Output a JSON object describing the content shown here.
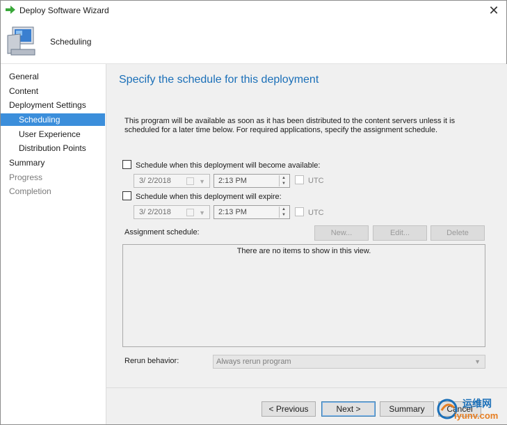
{
  "window": {
    "title": "Deploy Software Wizard",
    "close_glyph": "✕"
  },
  "header": {
    "title": "Scheduling",
    "icon": "computer-icon"
  },
  "nav": {
    "items": [
      {
        "label": "General",
        "level": "top",
        "state": "normal"
      },
      {
        "label": "Content",
        "level": "top",
        "state": "normal"
      },
      {
        "label": "Deployment Settings",
        "level": "top",
        "state": "normal"
      },
      {
        "label": "Scheduling",
        "level": "sub",
        "state": "selected"
      },
      {
        "label": "User Experience",
        "level": "sub",
        "state": "normal"
      },
      {
        "label": "Distribution Points",
        "level": "sub",
        "state": "normal"
      },
      {
        "label": "Summary",
        "level": "top",
        "state": "normal"
      },
      {
        "label": "Progress",
        "level": "top",
        "state": "disabled"
      },
      {
        "label": "Completion",
        "level": "top",
        "state": "disabled"
      }
    ]
  },
  "main": {
    "title": "Specify the schedule for this deployment",
    "description": "This program will be available as soon as it has been distributed to the content servers unless it is scheduled for a later time below. For required applications, specify the assignment schedule.",
    "available": {
      "label": "Schedule when this deployment will become available:",
      "checked": false,
      "date": "3/  2/2018",
      "time": "2:13 PM",
      "utc_label": "UTC"
    },
    "expire": {
      "label": "Schedule when this deployment will expire:",
      "checked": false,
      "date": "3/  2/2018",
      "time": "2:13 PM",
      "utc_label": "UTC"
    },
    "assignment": {
      "label": "Assignment schedule:",
      "new_label": "New...",
      "edit_label": "Edit...",
      "delete_label": "Delete",
      "empty_text": "There are no items to show in this view."
    },
    "rerun": {
      "label": "Rerun behavior:",
      "value": "Always rerun program"
    }
  },
  "footer": {
    "previous_label": "< Previous",
    "next_label": "Next >",
    "summary_label": "Summary",
    "cancel_label": "Cancel"
  },
  "watermark": {
    "text": "运维网",
    "sub": "iyunv.com"
  },
  "colors": {
    "accent": "#3b8edb",
    "title": "#1a6fb8",
    "content_bg": "#f0f0f0"
  }
}
